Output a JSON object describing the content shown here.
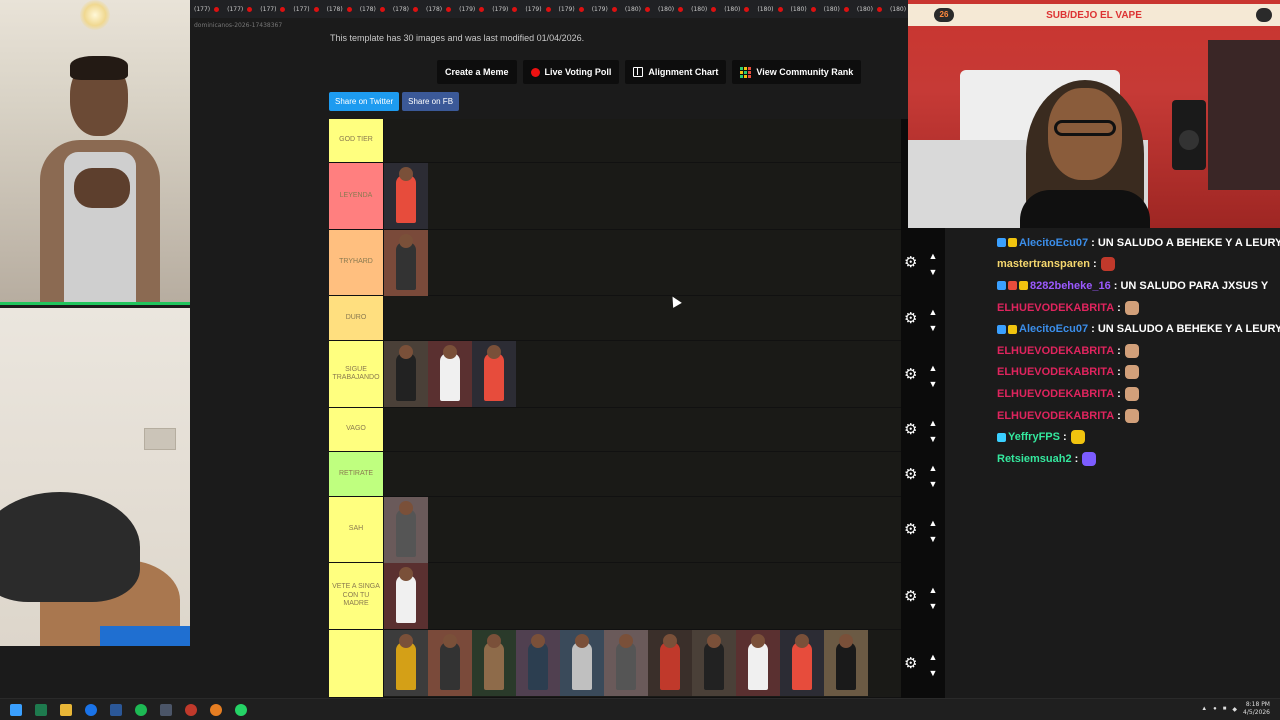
{
  "browser": {
    "tabs": [
      "(177)",
      "(177)",
      "(177)",
      "(177)",
      "(178)",
      "(178)",
      "(178)",
      "(178)",
      "(179)",
      "(179)",
      "(179)",
      "(179)",
      "(179)",
      "(180)",
      "(180)",
      "(180)",
      "(180)",
      "(180)",
      "(180)",
      "(180)",
      "(180)",
      "(180)",
      "(180)",
      "(180)",
      "(180)",
      "(180)",
      "(180)"
    ],
    "url": "dominicanos-2026-17438367"
  },
  "page": {
    "info_text": "This template has 30 images and was last modified 01/04/2026.",
    "buttons": {
      "create_meme": "Create a Meme",
      "live_voting": "Live Voting Poll",
      "alignment_chart": "Alignment Chart",
      "community_rank": "View Community Rank"
    },
    "share": {
      "twitter": "Share on Twitter",
      "facebook": "Share on FB"
    }
  },
  "tiers": [
    {
      "label": "GOD TIER",
      "color": "#ffff7f",
      "items": 0
    },
    {
      "label": "LEYENDA",
      "color": "#ff7f7f",
      "items": 1
    },
    {
      "label": "TRYHARD",
      "color": "#ffbf7f",
      "items": 1
    },
    {
      "label": "DURO",
      "color": "#ffdf7f",
      "items": 0
    },
    {
      "label": "SIGUE TRABAJANDO",
      "color": "#ffff7f",
      "items": 3
    },
    {
      "label": "VAGO",
      "color": "#ffff7f",
      "items": 0
    },
    {
      "label": "RETIRATE",
      "color": "#bfff7f",
      "items": 0
    },
    {
      "label": "SAH",
      "color": "#ffff7f",
      "items": 1
    },
    {
      "label": "VETE A SINGA CON TU MADRE",
      "color": "#ffff7f",
      "items": 1
    },
    {
      "label": "",
      "color": "#ffff7f",
      "items": 11
    }
  ],
  "stream": {
    "banner": "SUB/DEJO EL VAPE",
    "badge": "26"
  },
  "chat": [
    {
      "user": "AlecitoEcu07",
      "color": "#3b8eea",
      "message": ": UN SALUDO A BEHEKE Y A LEURY",
      "badges": [
        "#3aa0ff",
        "#f1c40f"
      ]
    },
    {
      "user": "mastertransparen",
      "color": "#f5d76e",
      "message": ":",
      "emote": "#c0392b",
      "badges": []
    },
    {
      "user": "8282beheke_16",
      "color": "#9b59ff",
      "message": ": UN SALUDO PARA JXSUS Y",
      "badges": [
        "#3aa0ff",
        "#e74c3c",
        "#f1c40f"
      ]
    },
    {
      "user": "ELHUEVODEKABRITA",
      "color": "#e0245e",
      "message": ":",
      "emote": "#d2a07a",
      "badges": []
    },
    {
      "user": "AlecitoEcu07",
      "color": "#3b8eea",
      "message": ": UN SALUDO A BEHEKE Y A LEURY",
      "badges": [
        "#3aa0ff",
        "#f1c40f"
      ]
    },
    {
      "user": "ELHUEVODEKABRITA",
      "color": "#e0245e",
      "message": ":",
      "emote": "#d2a07a",
      "badges": []
    },
    {
      "user": "ELHUEVODEKABRITA",
      "color": "#e0245e",
      "message": ":",
      "emote": "#d2a07a",
      "badges": []
    },
    {
      "user": "ELHUEVODEKABRITA",
      "color": "#e0245e",
      "message": ":",
      "emote": "#d2a07a",
      "badges": []
    },
    {
      "user": "ELHUEVODEKABRITA",
      "color": "#e0245e",
      "message": ":",
      "emote": "#d2a07a",
      "badges": []
    },
    {
      "user": "YeffryFPS",
      "color": "#34e89e",
      "message": ":",
      "emote": "#f1c40f",
      "badges": [
        "#3ad0ff"
      ]
    },
    {
      "user": "Retsiemsuah2",
      "color": "#34e89e",
      "message": ":",
      "emote": "#7c5cff",
      "badges": []
    }
  ],
  "taskbar": {
    "time": "8:18 PM",
    "date": "4/5/2026"
  }
}
